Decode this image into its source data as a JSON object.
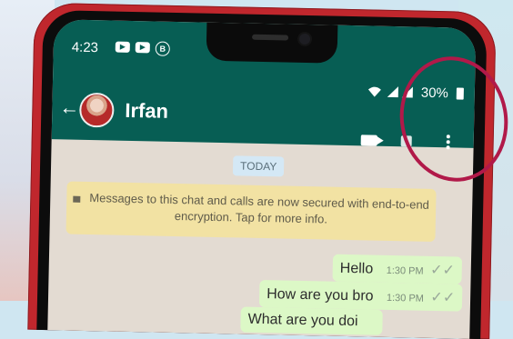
{
  "status_bar": {
    "time": "4:23",
    "battery_percent": "30%"
  },
  "chat_header": {
    "contact_name": "Irfan",
    "back_icon": "arrow-left-icon",
    "video_icon": "video-call-icon",
    "call_icon": "phone-call-icon",
    "more_icon": "more-vertical-icon"
  },
  "chat": {
    "date_chip": "TODAY",
    "encryption_notice": "Messages to this chat and calls are now secured with end-to-end encryption. Tap for more info.",
    "messages": [
      {
        "text": "Hello",
        "time": "1:30 PM"
      },
      {
        "text": "How are you bro",
        "time": "1:30 PM"
      },
      {
        "text": "What are you doi",
        "time": ""
      }
    ]
  },
  "colors": {
    "header_green": "#075e54",
    "bubble_green": "#dcf8c6",
    "notice_yellow": "#f2e2a3",
    "highlight_circle": "#b11949",
    "phone_red": "#c0272d"
  }
}
